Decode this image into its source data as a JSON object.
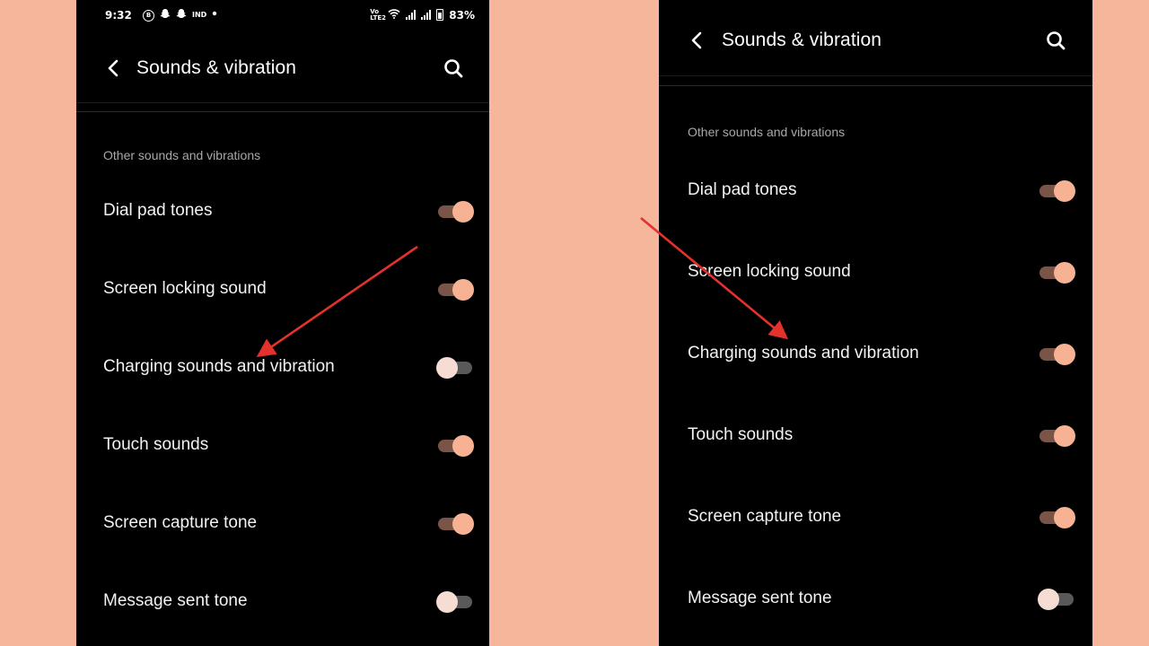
{
  "colors": {
    "background": "#f5b69c",
    "screen": "#000000",
    "toggle_on_thumb": "#f7b294",
    "toggle_on_track": "#7a5446",
    "toggle_off_thumb": "#f6ddd4",
    "toggle_off_track": "#595959",
    "annotation_arrow": "#e5312c"
  },
  "left_screen": {
    "status_bar": {
      "time": "9:32",
      "notification_icons": [
        "b-circle-icon",
        "snapchat-icon",
        "snapchat-icon",
        "ind-label",
        "dot-icon"
      ],
      "ind_label": "IND",
      "lte_label": "Vo LTE2",
      "battery": "83%"
    },
    "header": {
      "back_icon": "chevron-left-icon",
      "title": "Sounds & vibration",
      "search_icon": "search-icon"
    },
    "section_title": "Other sounds and vibrations",
    "settings": [
      {
        "label": "Dial pad tones",
        "enabled": true
      },
      {
        "label": "Screen locking sound",
        "enabled": true
      },
      {
        "label": "Charging sounds and vibration",
        "enabled": false
      },
      {
        "label": "Touch sounds",
        "enabled": true
      },
      {
        "label": "Screen capture tone",
        "enabled": true
      },
      {
        "label": "Message sent tone",
        "enabled": false
      }
    ]
  },
  "right_screen": {
    "header": {
      "back_icon": "chevron-left-icon",
      "title": "Sounds & vibration",
      "search_icon": "search-icon"
    },
    "section_title": "Other sounds and vibrations",
    "settings": [
      {
        "label": "Dial pad tones",
        "enabled": true
      },
      {
        "label": "Screen locking sound",
        "enabled": true
      },
      {
        "label": "Charging sounds and vibration",
        "enabled": true
      },
      {
        "label": "Touch sounds",
        "enabled": true
      },
      {
        "label": "Screen capture tone",
        "enabled": true
      },
      {
        "label": "Message sent tone",
        "enabled": false
      }
    ]
  },
  "annotations": [
    {
      "type": "arrow",
      "points_to": "Charging sounds and vibration",
      "screen": "left"
    },
    {
      "type": "arrow",
      "points_to": "Charging sounds and vibration",
      "screen": "right"
    }
  ]
}
